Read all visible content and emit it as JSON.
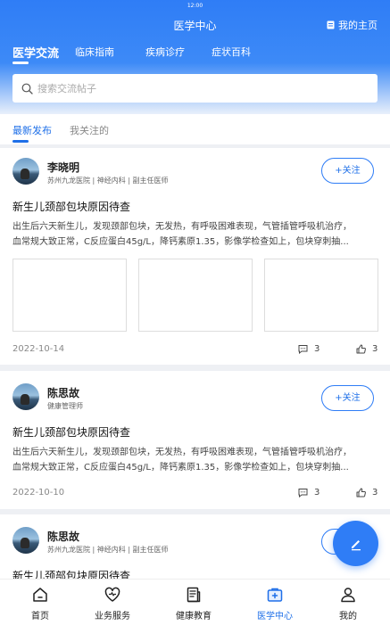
{
  "status_bar": {
    "time": "12:00"
  },
  "header": {
    "title": "医学中心",
    "my_home": "我的主页",
    "tabs": [
      {
        "label": "医学交流",
        "active": true
      },
      {
        "label": "临床指南",
        "active": false
      },
      {
        "label": "疾病诊疗",
        "active": false
      },
      {
        "label": "症状百科",
        "active": false
      }
    ]
  },
  "search": {
    "placeholder": "搜索交流帖子",
    "value": ""
  },
  "sub_tabs": [
    {
      "label": "最新发布",
      "active": true
    },
    {
      "label": "我关注的",
      "active": false
    }
  ],
  "posts": [
    {
      "author": "李晓明",
      "meta": "苏州九龙医院 | 神经内科 | 副主任医师",
      "follow_label": "+关注",
      "title": "新生儿颈部包块原因待查",
      "body_line1": "出生后六天新生儿，发现颈部包块，无发热，有呼吸困难表现，气管插管呼吸机治疗，",
      "body_line2": "血常规大致正常，C反应蛋白45g/L，降钙素原1.35，影像学检查如上，包块穿刺抽...",
      "image_count": 3,
      "date": "2022-10-14",
      "comments": "3",
      "likes": "3"
    },
    {
      "author": "陈思故",
      "meta": "健康管理师",
      "follow_label": "+关注",
      "title": "新生儿颈部包块原因待查",
      "body_line1": "出生后六天新生儿，发现颈部包块，无发热，有呼吸困难表现，气管插管呼吸机治疗，",
      "body_line2": "血常规大致正常，C反应蛋白45g/L，降钙素原1.35，影像学检查如上，包块穿刺抽...",
      "date": "2022-10-10",
      "comments": "3",
      "likes": "3"
    },
    {
      "author": "陈思故",
      "meta": "苏州九龙医院 | 神经内科 | 副主任医师",
      "follow_label": "+关注",
      "title": "新生儿颈部包块原因待查"
    }
  ],
  "bottom_nav": [
    {
      "label": "首页",
      "icon": "home-icon",
      "active": false
    },
    {
      "label": "业务服务",
      "icon": "heart-icon",
      "active": false
    },
    {
      "label": "健康教育",
      "icon": "document-icon",
      "active": false
    },
    {
      "label": "医学中心",
      "icon": "medical-kit-icon",
      "active": true
    },
    {
      "label": "我的",
      "icon": "user-icon",
      "active": false
    }
  ],
  "fab": {
    "icon": "edit-icon"
  },
  "colors": {
    "primary": "#2f7df6",
    "active_text": "#1e6fe8"
  }
}
